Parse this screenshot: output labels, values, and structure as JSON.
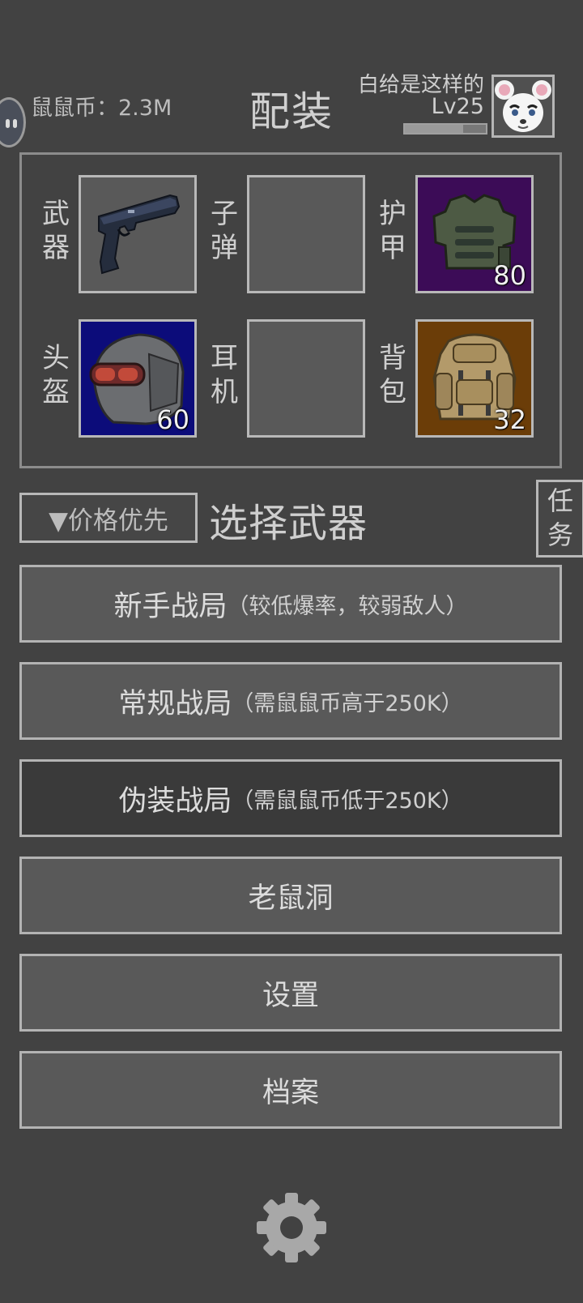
{
  "header": {
    "coins_label": "鼠鼠币：2.3M",
    "title": "配装",
    "player_name": "白给是这样的",
    "level": "Lv25",
    "xp_progress": 0.72
  },
  "equipment": {
    "slots": [
      {
        "label": "武器",
        "item": "pistol-icon",
        "value": ""
      },
      {
        "label": "子弹",
        "item": "",
        "value": ""
      },
      {
        "label": "护甲",
        "item": "body-armor-icon",
        "value": "80",
        "bg": "#3c0c57"
      },
      {
        "label": "头盔",
        "item": "helmet-icon",
        "value": "60",
        "bg": "#0c0c7a"
      },
      {
        "label": "耳机",
        "item": "",
        "value": ""
      },
      {
        "label": "背包",
        "item": "backpack-icon",
        "value": "32",
        "bg": "#6b3d08"
      }
    ]
  },
  "controls": {
    "sort_label": "▼价格优先",
    "select_weapon": "选择武器",
    "task_label": "任务"
  },
  "menu": [
    {
      "label": "新手战局",
      "sub": "（较低爆率，较弱敌人）"
    },
    {
      "label": "常规战局",
      "sub": "（需鼠鼠币高于250K）"
    },
    {
      "label": "伪装战局",
      "sub": "（需鼠鼠币低于250K）"
    },
    {
      "label": "老鼠洞",
      "sub": ""
    },
    {
      "label": "设置",
      "sub": ""
    },
    {
      "label": "档案",
      "sub": ""
    }
  ],
  "colors": {
    "background": "#424242",
    "border": "#b8b8b8"
  }
}
